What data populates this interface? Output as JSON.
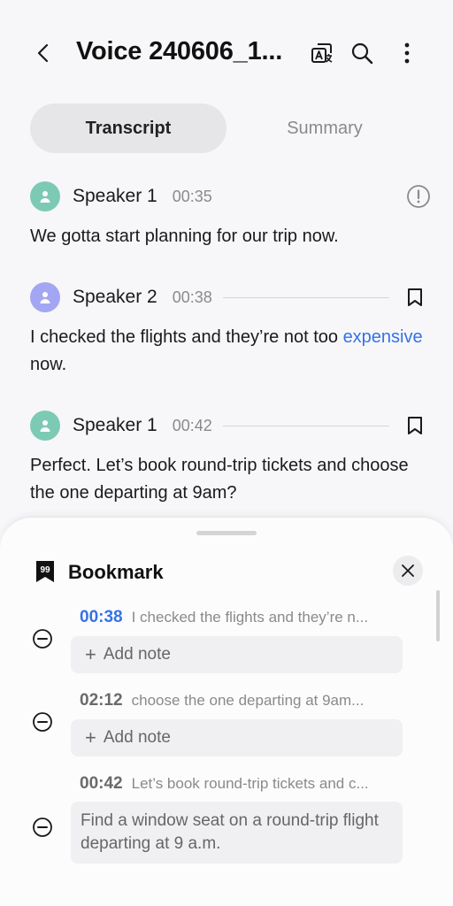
{
  "header": {
    "title": "Voice 240606_1...",
    "back_icon": "back-arrow-icon",
    "translate_icon": "translate-icon",
    "search_icon": "search-icon",
    "more_icon": "more-vertical-icon"
  },
  "tabs": [
    {
      "label": "Transcript",
      "active": true
    },
    {
      "label": "Summary",
      "active": false
    }
  ],
  "messages": [
    {
      "speaker": "Speaker 1",
      "time": "00:35",
      "avatar_color": "#7dcab4",
      "end_icon": "info-icon",
      "text_before": "We gotta start planning for our trip now.",
      "highlight": "",
      "text_after": ""
    },
    {
      "speaker": "Speaker 2",
      "time": "00:38",
      "avatar_color": "#a3a6f3",
      "end_icon": "bookmark-icon",
      "text_before": "I checked the flights and they’re not too ",
      "highlight": "expensive",
      "text_after": " now."
    },
    {
      "speaker": "Speaker 1",
      "time": "00:42",
      "avatar_color": "#7dcab4",
      "end_icon": "bookmark-icon",
      "text_before": "Perfect. Let’s book round-trip tickets and choose the one departing at 9am?",
      "highlight": "",
      "text_after": ""
    }
  ],
  "bookmark_panel": {
    "title": "Bookmark",
    "icon_badge": "99",
    "close_icon": "close-icon",
    "entries": [
      {
        "time": "00:38",
        "snippet": "I checked the flights and they’re n...",
        "active": true,
        "note": "",
        "add_note_label": "Add note"
      },
      {
        "time": "02:12",
        "snippet": "choose the one departing at 9am...",
        "active": false,
        "note": "",
        "add_note_label": "Add note"
      },
      {
        "time": "00:42",
        "snippet": "Let’s book round-trip tickets and c...",
        "active": false,
        "note": "Find a window seat on a round-trip flight departing at 9 a.m.",
        "add_note_label": ""
      }
    ]
  },
  "colors": {
    "accent": "#3572e5",
    "background": "#f7f7f9",
    "speaker1_avatar": "#7dcab4",
    "speaker2_avatar": "#a3a6f3"
  }
}
